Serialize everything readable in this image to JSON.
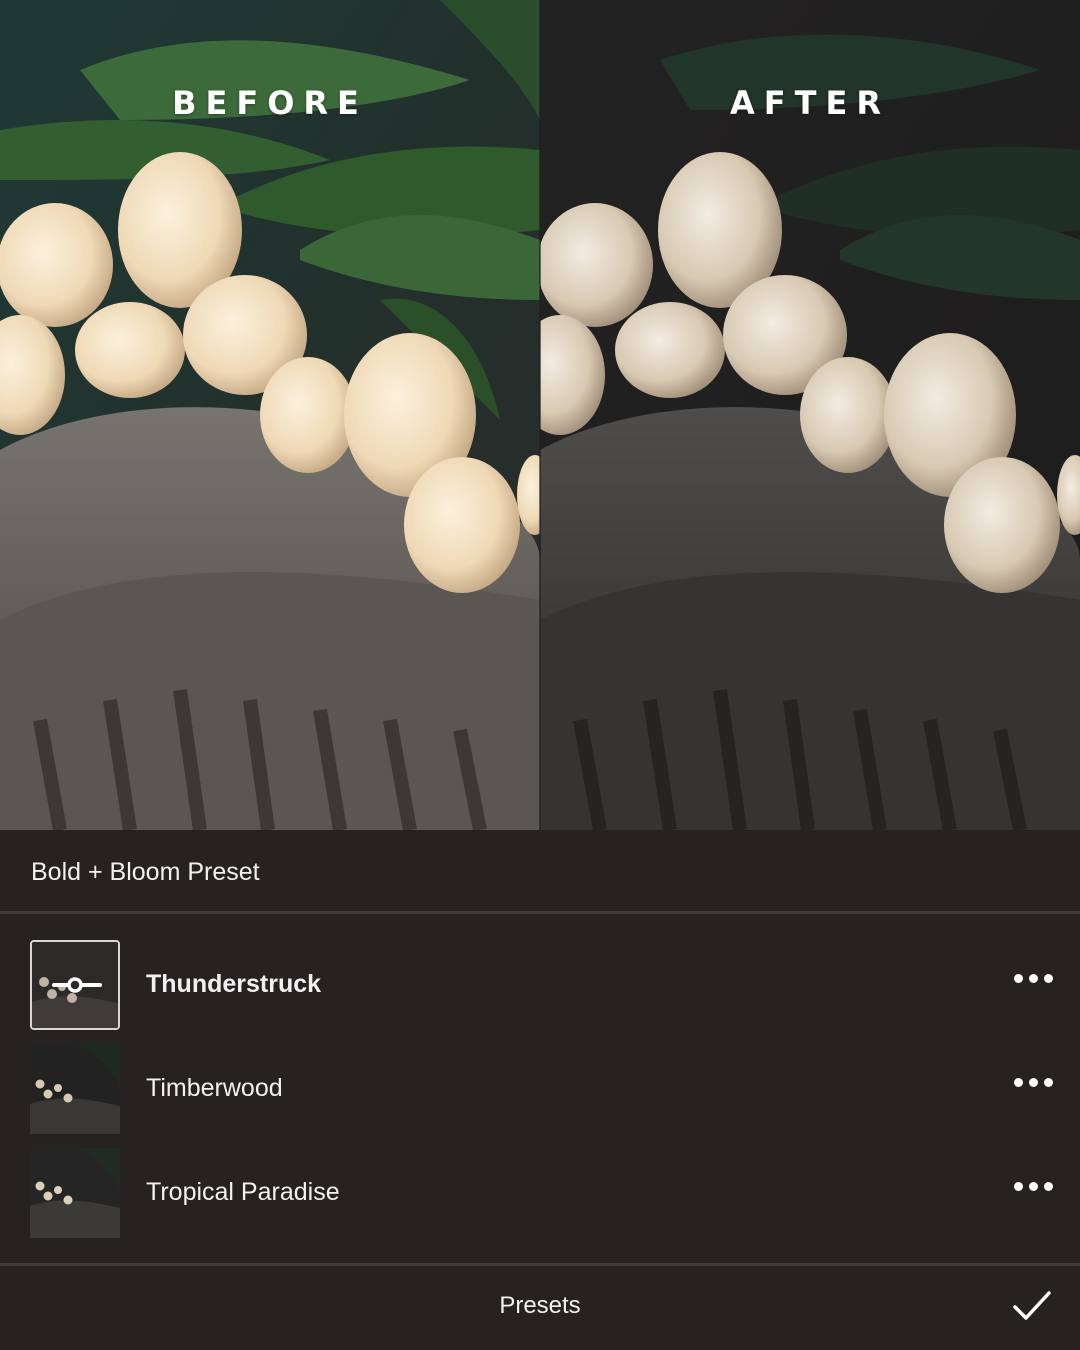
{
  "compare": {
    "before_label": "BEFORE",
    "after_label": "AFTER"
  },
  "panel": {
    "title": "Bold + Bloom Preset",
    "presets": [
      {
        "name": "Thunderstruck",
        "selected": true,
        "thumb_icon": "adjust-slider-icon",
        "more_icon": "more-dots-icon"
      },
      {
        "name": "Timberwood",
        "selected": false,
        "more_icon": "more-dots-icon"
      },
      {
        "name": "Tropical Paradise",
        "selected": false,
        "more_icon": "more-dots-icon"
      }
    ],
    "footer_label": "Presets",
    "confirm_icon": "checkmark-icon"
  },
  "colors": {
    "panel_bg": "#262222",
    "separator": "#3f3b3b",
    "text": "#f2f0f0"
  }
}
